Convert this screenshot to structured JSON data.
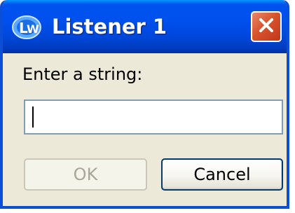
{
  "window": {
    "title": "Listener 1",
    "app_icon": "lw-app-icon",
    "close_icon": "close-icon"
  },
  "dialog": {
    "prompt_label": "Enter a string:",
    "input_value": "",
    "ok_label": "OK",
    "ok_enabled": false,
    "cancel_label": "Cancel"
  },
  "colors": {
    "titlebar": "#0050ee",
    "frame": "#0a4fd6",
    "body": "#ece9d8",
    "close_button": "#d8532d"
  }
}
